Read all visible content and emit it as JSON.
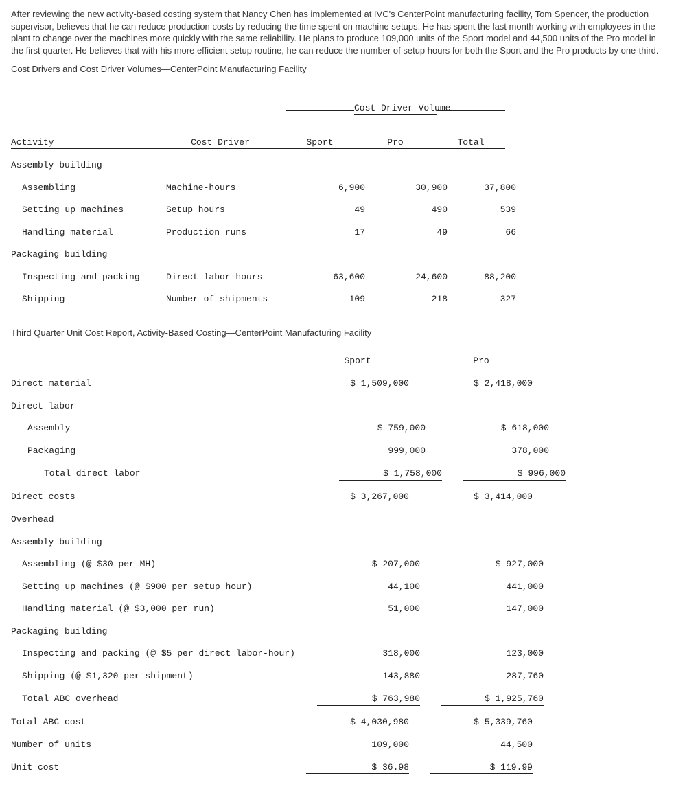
{
  "intro": {
    "p1": "After reviewing the new activity-based costing system that Nancy Chen has implemented at IVC's CenterPoint manufacturing facility, Tom Spencer, the production supervisor, believes that he can reduce production costs by reducing the time spent on machine setups. He has spent the last month working with employees in the plant to change over the machines more quickly with the same reliability. He plans to produce 109,000 units of the Sport model and 44,500 units of the Pro model in the first quarter. He believes that with his more efficient setup routine, he can reduce the number of setup hours for both the Sport and the Pro products by one-third."
  },
  "t1": {
    "title": "Cost Drivers and Cost Driver Volumes—CenterPoint Manufacturing Facility",
    "group_hdr": "Cost Driver Volume",
    "hdr": {
      "activity": "Activity",
      "driver": "Cost Driver",
      "sport": "Sport",
      "pro": "Pro",
      "total": "Total"
    },
    "sec1": "Assembly building",
    "r1": {
      "a": "Assembling",
      "d": "Machine-hours",
      "s": "6,900",
      "p": "30,900",
      "t": "37,800"
    },
    "r2": {
      "a": "Setting up machines",
      "d": "Setup hours",
      "s": "49",
      "p": "490",
      "t": "539"
    },
    "r3": {
      "a": "Handling material",
      "d": "Production runs",
      "s": "17",
      "p": "49",
      "t": "66"
    },
    "sec2": "Packaging building",
    "r4": {
      "a": "Inspecting and packing",
      "d": "Direct labor-hours",
      "s": "63,600",
      "p": "24,600",
      "t": "88,200"
    },
    "r5": {
      "a": "Shipping",
      "d": "Number of shipments",
      "s": "109",
      "p": "218",
      "t": "327"
    }
  },
  "t2": {
    "title": "Third Quarter Unit Cost Report, Activity-Based Costing—CenterPoint Manufacturing Facility",
    "hdr": {
      "sport": "Sport",
      "pro": "Pro"
    },
    "l_dm": "Direct material",
    "dm_s": "$ 1,509,000",
    "dm_p": "$ 2,418,000",
    "l_dl": "Direct labor",
    "l_asm": "Assembly",
    "asm_s": "$ 759,000",
    "asm_p": "$ 618,000",
    "l_pkg": "Packaging",
    "pkg_s": "999,000",
    "pkg_p": "378,000",
    "l_tdl": "Total direct labor",
    "tdl_s": "$ 1,758,000",
    "tdl_p": "$ 996,000",
    "l_dc": "Direct costs",
    "dc_s": "$ 3,267,000",
    "dc_p": "$ 3,414,000",
    "l_oh": "Overhead",
    "l_ab": "Assembly building",
    "l_a_asm": "Assembling (@ $30 per MH)",
    "a_asm_s": "$ 207,000",
    "a_asm_p": "$ 927,000",
    "l_a_set": "Setting up machines (@ $900 per setup hour)",
    "a_set_s": "44,100",
    "a_set_p": "441,000",
    "l_a_hm": "Handling material (@ $3,000 per run)",
    "a_hm_s": "51,000",
    "a_hm_p": "147,000",
    "l_pb": "Packaging building",
    "l_p_ip": "Inspecting and packing (@ $5 per direct labor-hour)",
    "p_ip_s": "318,000",
    "p_ip_p": "123,000",
    "l_p_sh": "Shipping (@ $1,320 per shipment)",
    "p_sh_s": "143,880",
    "p_sh_p": "287,760",
    "l_tao": "Total ABC overhead",
    "tao_s": "$ 763,980",
    "tao_p": "$ 1,925,760",
    "l_tac": "Total ABC cost",
    "tac_s": "$ 4,030,980",
    "tac_p": "$ 5,339,760",
    "l_nu": "Number of units",
    "nu_s": "109,000",
    "nu_p": "44,500",
    "l_uc": "Unit cost",
    "uc_s": "$ 36.98",
    "uc_p": "$ 119.99"
  }
}
